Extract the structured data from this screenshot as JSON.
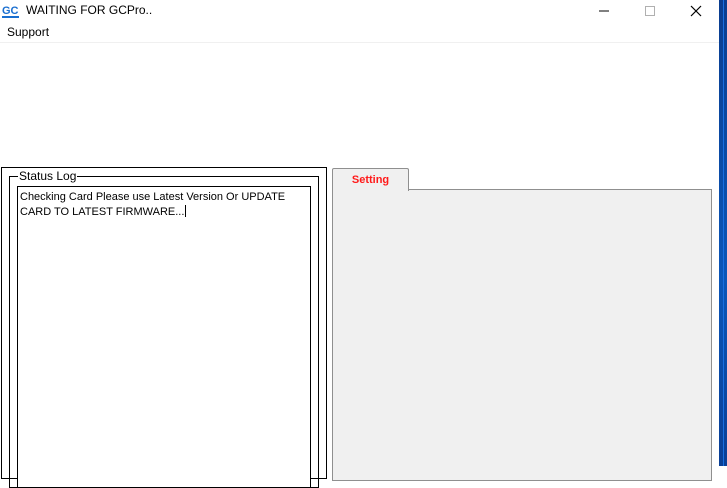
{
  "window": {
    "title": "WAITING FOR GCPro..",
    "icon": "gc-logo-icon",
    "controls": [
      "minimize-icon",
      "maximize-icon",
      "close-icon"
    ]
  },
  "menu": {
    "items": [
      {
        "label": "Support"
      }
    ]
  },
  "status_log": {
    "title": "Status Log",
    "text": "Checking Card Please use Latest Version Or UPDATE CARD TO LATEST FIRMWARE..."
  },
  "tabs": [
    {
      "label": "Setting",
      "color": "#ff1a1a"
    }
  ]
}
